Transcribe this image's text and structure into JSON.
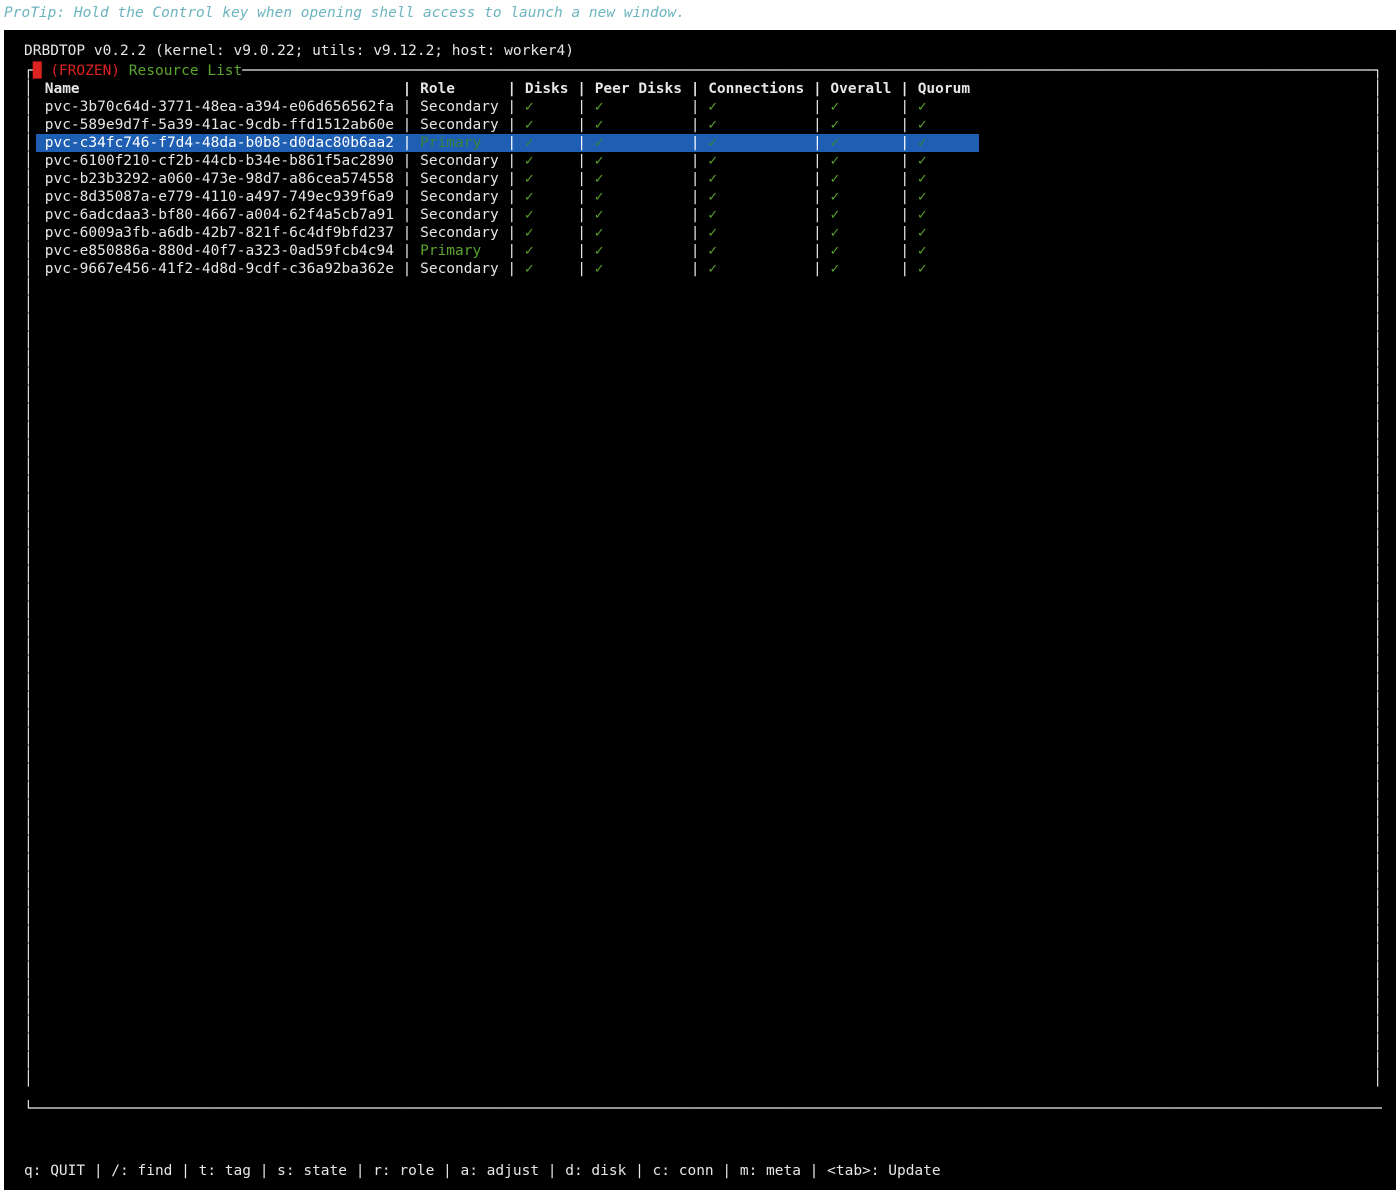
{
  "protip": "ProTip: Hold the Control key when opening shell access to launch a new window.",
  "title": "DRBDTOP v0.2.2 (kernel: v9.0.22; utils: v9.12.2; host: worker4)",
  "frame": {
    "frozen": "(FROZEN)",
    "section": "Resource List"
  },
  "columns": [
    "Name",
    "Role",
    "Disks",
    "Peer Disks",
    "Connections",
    "Overall",
    "Quorum"
  ],
  "rows": [
    {
      "name": "pvc-3b70c64d-3771-48ea-a394-e06d656562fa",
      "role": "Secondary",
      "disks": "✓",
      "peer": "✓",
      "conn": "✓",
      "overall": "✓",
      "quorum": "✓",
      "selected": false
    },
    {
      "name": "pvc-589e9d7f-5a39-41ac-9cdb-ffd1512ab60e",
      "role": "Secondary",
      "disks": "✓",
      "peer": "✓",
      "conn": "✓",
      "overall": "✓",
      "quorum": "✓",
      "selected": false
    },
    {
      "name": "pvc-c34fc746-f7d4-48da-b0b8-d0dac80b6aa2",
      "role": "Primary",
      "disks": "✓",
      "peer": "✓",
      "conn": "✓",
      "overall": "✓",
      "quorum": "✓",
      "selected": true
    },
    {
      "name": "pvc-6100f210-cf2b-44cb-b34e-b861f5ac2890",
      "role": "Secondary",
      "disks": "✓",
      "peer": "✓",
      "conn": "✓",
      "overall": "✓",
      "quorum": "✓",
      "selected": false
    },
    {
      "name": "pvc-b23b3292-a060-473e-98d7-a86cea574558",
      "role": "Secondary",
      "disks": "✓",
      "peer": "✓",
      "conn": "✓",
      "overall": "✓",
      "quorum": "✓",
      "selected": false
    },
    {
      "name": "pvc-8d35087a-e779-4110-a497-749ec939f6a9",
      "role": "Secondary",
      "disks": "✓",
      "peer": "✓",
      "conn": "✓",
      "overall": "✓",
      "quorum": "✓",
      "selected": false
    },
    {
      "name": "pvc-6adcdaa3-bf80-4667-a004-62f4a5cb7a91",
      "role": "Secondary",
      "disks": "✓",
      "peer": "✓",
      "conn": "✓",
      "overall": "✓",
      "quorum": "✓",
      "selected": false
    },
    {
      "name": "pvc-6009a3fb-a6db-42b7-821f-6c4df9bfd237",
      "role": "Secondary",
      "disks": "✓",
      "peer": "✓",
      "conn": "✓",
      "overall": "✓",
      "quorum": "✓",
      "selected": false
    },
    {
      "name": "pvc-e850886a-880d-40f7-a323-0ad59fcb4c94",
      "role": "Primary",
      "disks": "✓",
      "peer": "✓",
      "conn": "✓",
      "overall": "✓",
      "quorum": "✓",
      "selected": false
    },
    {
      "name": "pvc-9667e456-41f2-4d8d-9cdf-c36a92ba362e",
      "role": "Secondary",
      "disks": "✓",
      "peer": "✓",
      "conn": "✓",
      "overall": "✓",
      "quorum": "✓",
      "selected": false
    }
  ],
  "helpbar": "q: QUIT | /: find | t: tag | s: state | r: role | a: adjust | d: disk | c: conn | m: meta | <tab>: Update",
  "colors": {
    "green": "#5aa52e",
    "selected_bg": "#1e5fb3",
    "frozen": "#d22"
  }
}
